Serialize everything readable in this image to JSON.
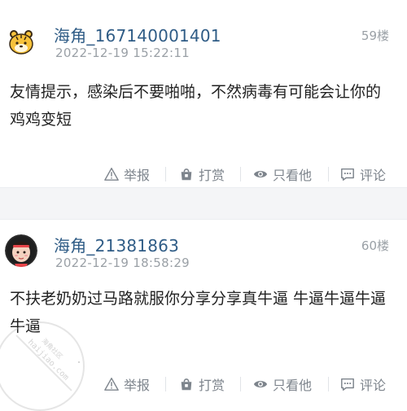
{
  "posts": [
    {
      "username": "海角_167140001401",
      "timestamp": "2022-12-19 15:22:11",
      "floor": "59楼",
      "content": "友情提示，感染后不要啪啪，不然病毒有可能会让你的鸡鸡变短",
      "avatar": "tiger-avatar",
      "actions": {
        "report": "举报",
        "tip": "打赏",
        "only_author": "只看他",
        "comment": "评论"
      }
    },
    {
      "username": "海角_21381863",
      "timestamp": "2022-12-19 18:58:29",
      "floor": "60楼",
      "content": "不扶老奶奶过马路就服你分享分享真牛逼 牛逼牛逼牛逼牛逼",
      "avatar": "girl-avatar",
      "actions": {
        "report": "举报",
        "tip": "打赏",
        "only_author": "只看他",
        "comment": "评论"
      }
    }
  ],
  "watermark": {
    "domain": "haijiao.com",
    "name": "海角社区"
  },
  "colors": {
    "username": "#2f5c86",
    "muted": "#9aa0a6",
    "text": "#222222",
    "action": "#7d848c"
  }
}
